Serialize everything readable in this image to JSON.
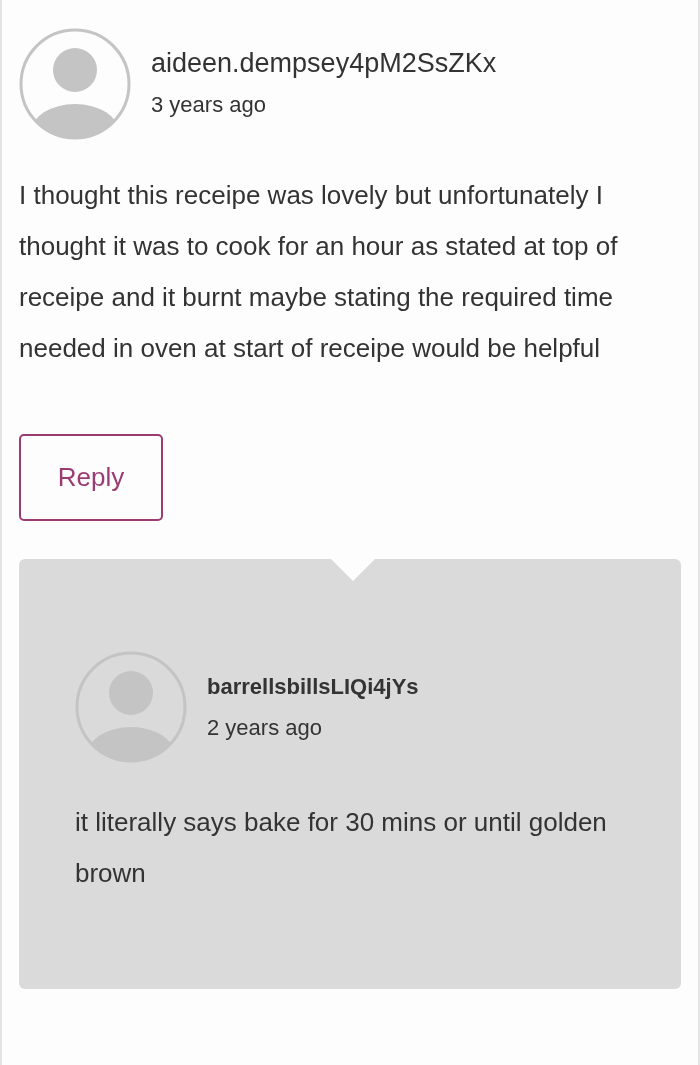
{
  "comment": {
    "username": "aideen.dempsey4pM2SsZKx",
    "time": "3 years ago",
    "text": "I thought this receipe was lovely but unfortunately I thought it was to cook for an hour as stated at top of receipe and it burnt maybe stating the required time needed in oven at start of receipe would be helpful",
    "reply_button": "Reply"
  },
  "replies": [
    {
      "username": "barrellsbillsLIQi4jYs",
      "time": "2 years ago",
      "text": "it literally says bake for 30 mins or until golden brown"
    }
  ]
}
